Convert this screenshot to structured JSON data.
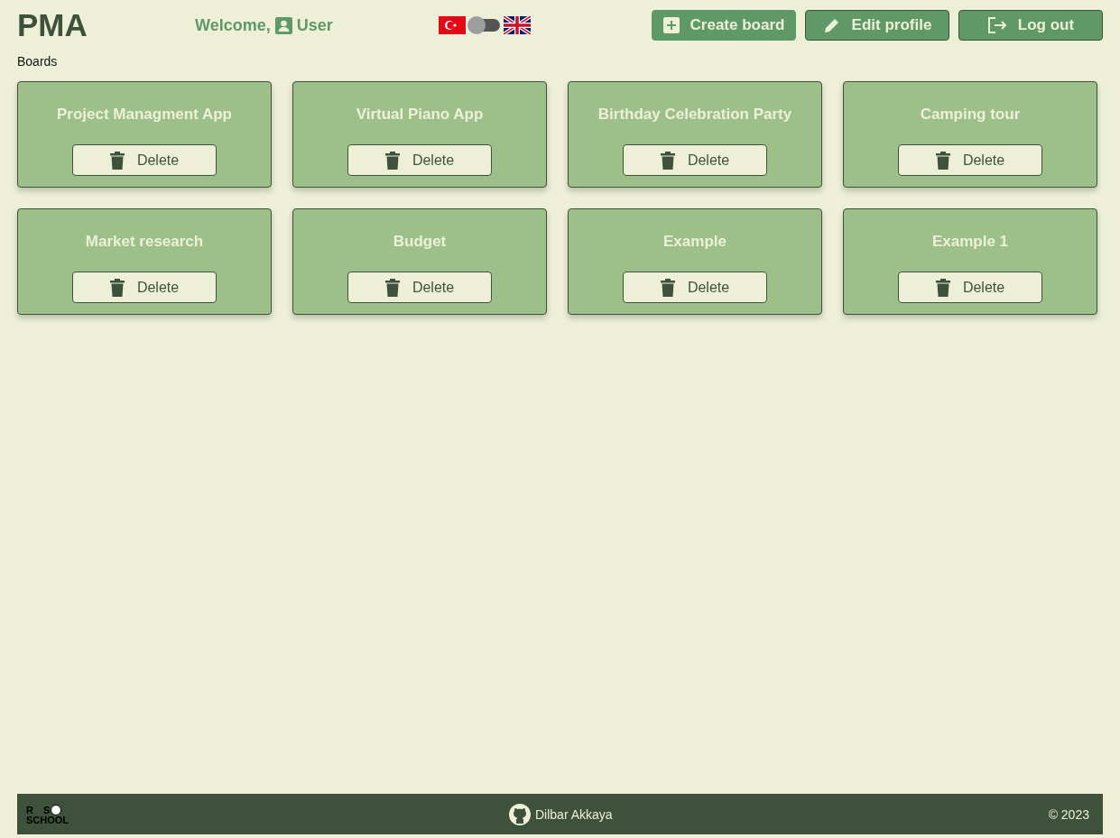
{
  "header": {
    "logo": "PMA",
    "welcome": "Welcome,",
    "user": "User",
    "language_switch": {
      "on": false
    },
    "buttons": [
      {
        "kind": "create",
        "label": "Create board"
      },
      {
        "kind": "edit",
        "label": "Edit profile"
      },
      {
        "kind": "logout",
        "label": "Log out"
      }
    ]
  },
  "page_title": "Boards",
  "boards": [
    {
      "title": "Project Managment App",
      "delete": "Delete"
    },
    {
      "title": "Virtual Piano App",
      "delete": "Delete"
    },
    {
      "title": "Birthday Celebration Party",
      "delete": "Delete"
    },
    {
      "title": "Camping tour",
      "delete": "Delete"
    },
    {
      "title": "Market research",
      "delete": "Delete"
    },
    {
      "title": "Budget",
      "delete": "Delete"
    },
    {
      "title": "Example",
      "delete": "Delete"
    },
    {
      "title": "Example 1",
      "delete": "Delete"
    }
  ],
  "footer": {
    "logo_top": [
      "R",
      "S"
    ],
    "logo_bottom": [
      "SC",
      "HO",
      "OL"
    ],
    "author": "Dilbar Akkaya",
    "copyright": "© 2023"
  }
}
